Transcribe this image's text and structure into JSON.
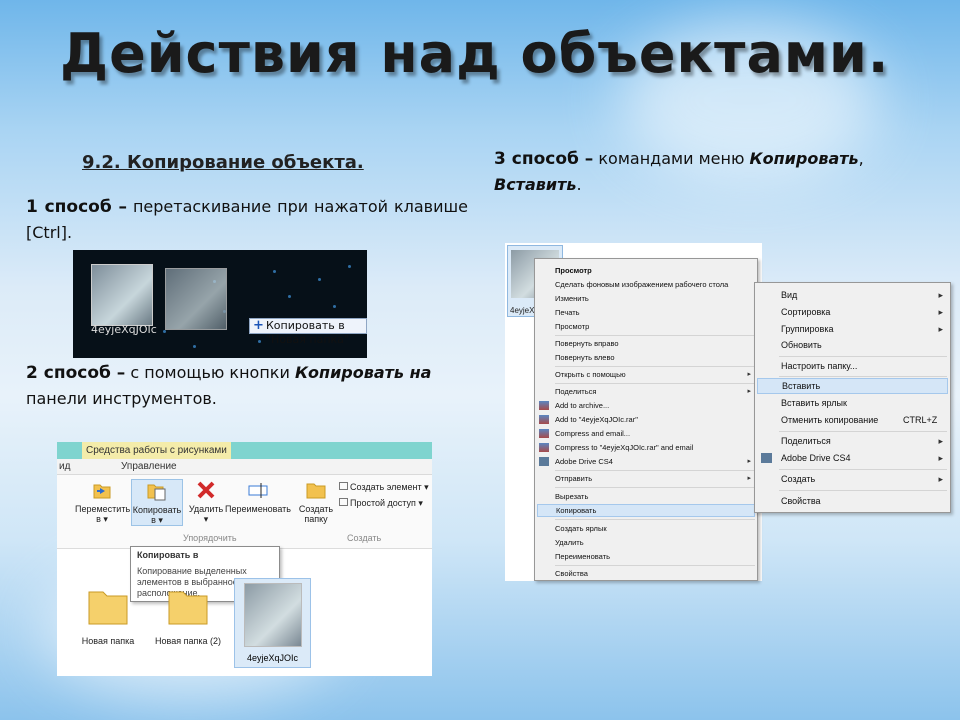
{
  "slide": {
    "title": "Действия над объектами.",
    "subheading": "9.2. Копирование объекта.",
    "method1": {
      "lead": "1 способ –",
      "text": " перетаскивание при нажатой клавише [Ctrl]."
    },
    "method2": {
      "lead": "2 способ –",
      "text": " с помощью кнопки ",
      "italic": "Копировать на",
      "text2": " панели инструментов."
    },
    "method3": {
      "lead": "3 способ –",
      "text": " командами меню ",
      "italic1": "Копировать",
      "comma": ", ",
      "italic2": "Вставить",
      "end": "."
    }
  },
  "shot1": {
    "filename": "4eyjeXqJOIc",
    "drag_label": "Копировать в \"Новая папка\"",
    "drag_plus": "+"
  },
  "shot2": {
    "context_tab": "Средства работы с рисунками",
    "tab_left": "ид",
    "tab_manage": "Управление",
    "buttons": {
      "move": "Переместить в ▾",
      "copy": "Копировать в ▾",
      "delete": "Удалить ▾",
      "rename": "Переименовать",
      "new_folder": "Создать папку"
    },
    "new_item": "Создать элемент ▾",
    "easy_access": "Простой доступ ▾",
    "group_organize": "Упорядочить",
    "group_create": "Создать",
    "tooltip": {
      "title": "Копировать в",
      "text": "Копирование выделенных элементов в выбранное расположение."
    },
    "items": [
      "Новая папка",
      "Новая папка (2)",
      "4eyjeXqJOIc"
    ]
  },
  "shot3": {
    "thumb_label": "4eyjeXq",
    "menu": [
      "Просмотр",
      "Сделать фоновым изображением рабочего стола",
      "Изменить",
      "Печать",
      "Просмотр",
      "Повернуть вправо",
      "Повернуть влево",
      "Открыть с помощью",
      "Поделиться",
      "Add to archive...",
      "Add to \"4eyjeXqJOIc.rar\"",
      "Compress and email...",
      "Compress to \"4eyjeXqJOIc.rar\" and email",
      "Adobe Drive CS4",
      "Отправить",
      "Вырезать",
      "Копировать",
      "Создать ярлык",
      "Удалить",
      "Переименовать",
      "Свойства"
    ],
    "menu2": [
      "Вид",
      "Сортировка",
      "Группировка",
      "Обновить",
      "Настроить папку...",
      "Вставить",
      "Вставить ярлык",
      "Отменить копирование",
      "Поделиться",
      "Adobe Drive CS4",
      "Создать",
      "Свойства"
    ],
    "undo_shortcut": "CTRL+Z",
    "arrow": "▸"
  }
}
